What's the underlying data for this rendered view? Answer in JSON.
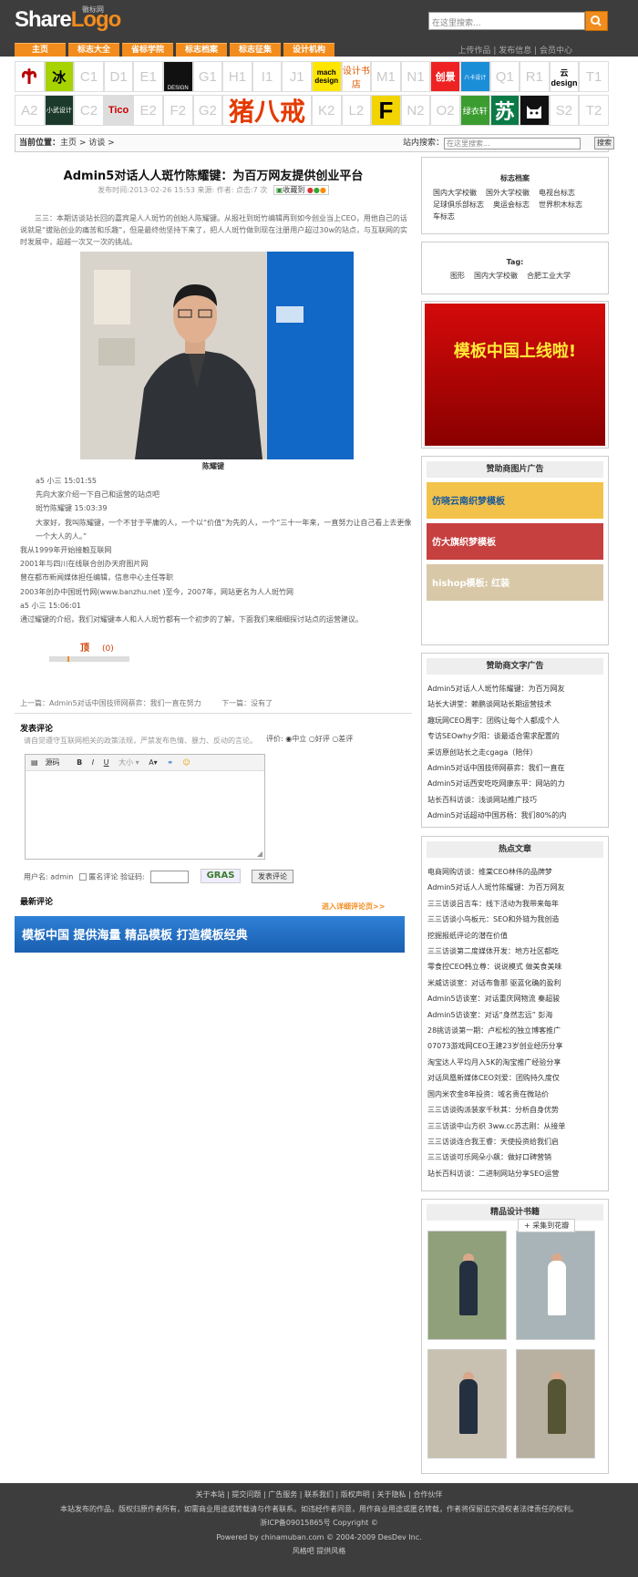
{
  "header": {
    "logo_share": "Share",
    "logo_logo": "Logo",
    "logo_sub": "徽标网",
    "search_placeholder": "在这里搜索...",
    "nav": [
      "主页",
      "标志大全",
      "省标学院",
      "标志档案",
      "标志征集",
      "设计机构"
    ],
    "toplinks": "上传作品 | 发布信息 | 会员中心"
  },
  "logowall": {
    "row1": [
      "",
      "冰",
      "C1",
      "D1",
      "E1",
      "DESIGN",
      "G1",
      "H1",
      "I1",
      "J1",
      "mach design",
      "设计书店",
      "M1",
      "N1",
      "创景",
      "八卡设计",
      "Q1",
      "R1",
      "云design",
      "T1"
    ],
    "row2": [
      "A2",
      "小武设计",
      "C2",
      "Tico",
      "E2",
      "F2",
      "G2",
      "猪八戒",
      "",
      "",
      "K2",
      "L2",
      "F",
      "N2",
      "O2",
      "绿衣轩",
      "苏",
      "",
      "S2",
      "T2"
    ]
  },
  "breadcrumb": {
    "label": "当前位置：",
    "path": "主页 > 访谈 >",
    "search_label": "站内搜索：",
    "search_placeholder": "在这里搜索...",
    "search_button": "搜索"
  },
  "article": {
    "title": "Admin5对话人人斑竹陈耀键：为百万网友提供创业平台",
    "meta": "发布时间:2013-02-26 15:53  来源:  作者:  点击:7 次",
    "collect": "收藏到",
    "summary": "三三：本期访谈站长回的嘉宾是人人斑竹的创始人陈耀键。从报社到斑竹编辑再到如今创业当上CEO，用他自己的话说就是“拔贴创业的痛苦和乐趣”，但是最终他坚持下来了，把人人斑竹做到现在注册用户超过30w的站点，与互联网的实时发展中，超越一次又一次的挑战。",
    "caption": "陈耀键",
    "body": [
      "a5 小三 15:01:55",
      "先向大家介绍一下自己和运营的站点吧",
      "斑竹陈耀键 15:03:39",
      "大家好，我叫陈耀键，一个不甘于平庸的人，一个以“价值”为先的人，一个“三十一年来，一直努力让自己看上去更像一个大人的人。”",
      "我从1999年开始接触互联网",
      "2001年与四川在线联合创办天府图片网",
      "曾在都市新闻媒体担任编辑，信息中心主任等职",
      "2003年创办中国斑竹网(www.banzhu.net )至今，2007年，网站更名为人人斑竹网",
      "a5 小三 15:06:01",
      "通过耀键的介绍，我们对耀键本人和人人斑竹都有一个初步的了解，下面我们来细细探讨站点的运营建议。"
    ],
    "vote_label": "顶",
    "vote_count": "(0)",
    "prev": "上一篇：Admin5对话中国技师网蔡弈：我们一直在努力",
    "next": "下一篇：没有了"
  },
  "comments": {
    "title": "发表评论",
    "note": "请自觉遵守互联网相关的政策法规，严禁发布色情、暴力、反动的言论。",
    "rating_label": "评价:",
    "rating_options": [
      "中立",
      "好评",
      "差评"
    ],
    "editor_source": "源码",
    "username_label": "用户名:",
    "username": "admin",
    "anon_label": "匿名评论",
    "captcha_label": "验证码:",
    "captcha": "GRAS",
    "submit": "发表评论",
    "latest_title": "最新评论",
    "more": "进入详细评论页>>"
  },
  "banner": {
    "text": "模板中国 提供海量 精品模板 打造模板经典"
  },
  "sidebar": {
    "archive_title": "标志档案",
    "archive_items": [
      "国内大学校徽",
      "国外大学校徽",
      "电视台标志",
      "足球俱乐部标志",
      "奥运会标志",
      "世界积木标志",
      "车标志"
    ],
    "tag_title": "Tag:",
    "tags": [
      "图形",
      "国内大学校徽",
      "合肥工业大学"
    ],
    "ad_text": "模板中国上线啦!",
    "img_sponsor_title": "赞助商图片广告",
    "img_ads": [
      "仿晓云南织梦模板",
      "仿大旗织梦模板",
      "hishop模板: 红装"
    ],
    "text_sponsor_title": "赞助商文字广告",
    "text_ads": [
      "Admin5对话人人斑竹陈耀键：为百万网友",
      "站长大讲堂：赖鹏谈网站长期运营技术",
      "趣玩网CEO周宇：团购让每个人都成个人",
      "专访SEOwhy夕阳：谈最适合需求配置的",
      "采访原创站长之走cgaga（陪伴）",
      "Admin5对话中国技师网蔡弈：我们一直在",
      "Admin5对话西安吃吃网康东平：网站的力",
      "站长百科访谈：浅谈网站推广技巧",
      "Admin5对话超动中国苏杨：我们80%的内"
    ],
    "hot_title": "热点文章",
    "hot": [
      "电商网购访谈：维棠CEO林伟的品牌梦",
      "Admin5对话人人斑竹陈耀键：为百万网友",
      "三三访谈吕吉车：线下活动为我带来每年",
      "三三访谈小鸟板元：SEO和外链为我创造",
      "挖掘报纸评论的潜在价值",
      "三三访谈第二度媒体开发：地方社区都吃",
      "零食控CEO韩立尊：说说模式 做美食美味",
      "米威访谈室：对话布鲁那 驱蓝化确的盈利",
      "Admin5访谈室：对话重庆网物流 秦超骏",
      "Admin5访谈室：对话“身然志远” 彭海",
      "28挑访谈第一期：卢松松的独立博客推广",
      "07073游戏网CEO王建23岁创业经历分享",
      "淘宝达人平均月入5K的淘宝推广经验分享",
      "对话凤凰新媒体CEO刘爱：团购持久度仅",
      "国内米农金8年投资：域名贵在微站价",
      "三三访谈购派装家千秋其：分析自身优势",
      "三三访谈中山方织 3ww.cc苏志刚：从接单",
      "三三访谈连合我王睿：天使投资给我们启",
      "三三访谈可乐网朵小飙：做好口碑营销",
      "站长百科访谈：二进制网站分享SEO运营"
    ],
    "books_title": "精品设计书籍",
    "books_tip": "采集到花瓣"
  },
  "footer": {
    "links": "关于本站 | 提交问题 | 广告服务 | 联系我们 | 版权声明 | 关于隐私 | 合作伙伴",
    "copyright_note": "本站发布的作品，版权归原作者所有，如需商业用途或转载请与作者联系。如违经作者同意，用作商业用途或匿名转载，作者将保留追究侵权者法律责任的权利。",
    "icp": "浙ICP备09015865号  Copyright ©",
    "powered": "Powered by chinamuban.com © 2004-2009 DesDev Inc.",
    "extra": "风格吧 提供风格"
  }
}
